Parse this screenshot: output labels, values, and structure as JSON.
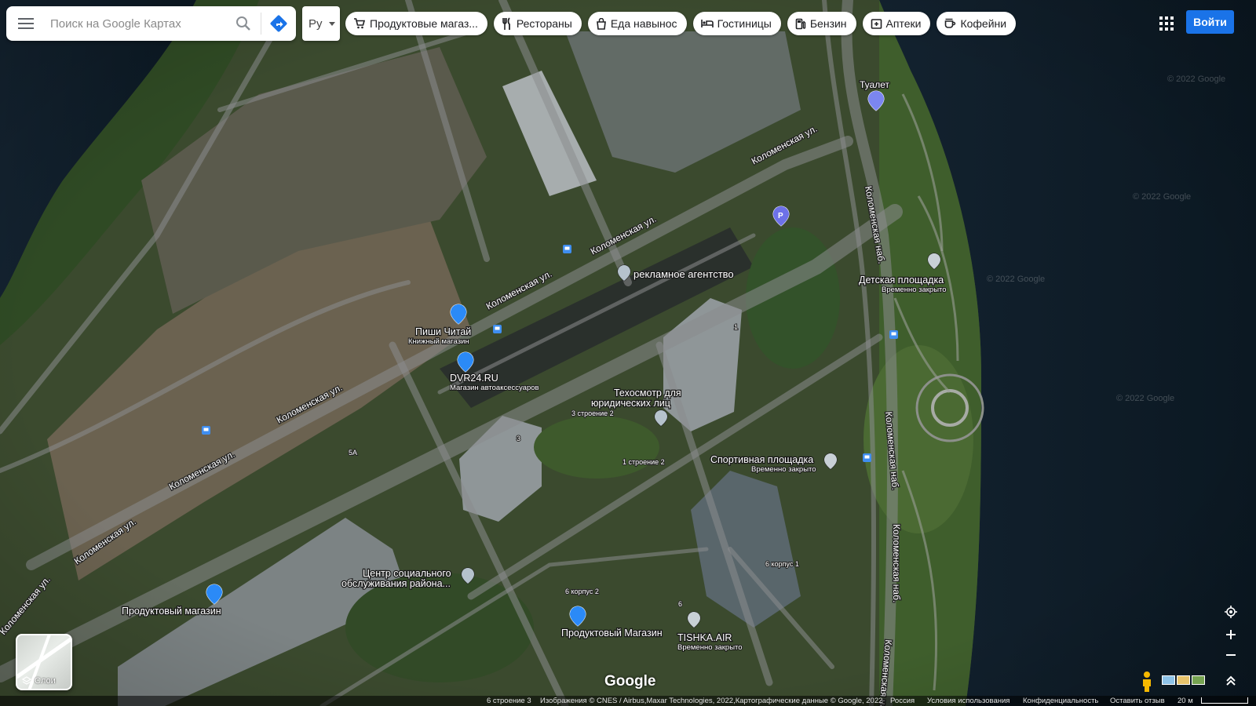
{
  "search": {
    "placeholder": "Поиск на Google Картах"
  },
  "language": {
    "selected": "Ру"
  },
  "chips": [
    {
      "label": "Продуктовые магаз...",
      "icon": "cart-icon"
    },
    {
      "label": "Рестораны",
      "icon": "fork-knife-icon"
    },
    {
      "label": "Еда навынос",
      "icon": "takeout-bag-icon"
    },
    {
      "label": "Гостиницы",
      "icon": "bed-icon"
    },
    {
      "label": "Бензин",
      "icon": "fuel-pump-icon"
    },
    {
      "label": "Аптеки",
      "icon": "pharmacy-icon"
    },
    {
      "label": "Кофейни",
      "icon": "coffee-cup-icon"
    }
  ],
  "header": {
    "login_label": "Войти"
  },
  "layers": {
    "label": "Слои"
  },
  "streets": [
    {
      "name": "Коломенская ул."
    },
    {
      "name": "Коломенская ул."
    },
    {
      "name": "Коломенская ул."
    },
    {
      "name": "Коломенская ул."
    },
    {
      "name": "Коломенская ул."
    },
    {
      "name": "Коломенская ул."
    },
    {
      "name": "Коломенская ул."
    },
    {
      "name": "Коломенская наб."
    },
    {
      "name": "Коломенская наб."
    },
    {
      "name": "Коломенская наб."
    },
    {
      "name": "Коломенская наб."
    }
  ],
  "places": [
    {
      "name": "Туалет",
      "sub": "",
      "icon": "restroom-pin-icon",
      "color": "#7b86f0"
    },
    {
      "name": "",
      "sub": "",
      "icon": "parking-pin-icon",
      "color": "#6d71e8"
    },
    {
      "name": "рекламное агентство",
      "sub": "",
      "icon": "place-pin-icon",
      "color": "#b5c2cc"
    },
    {
      "name": "Детская площадка",
      "sub": "Временно закрыто",
      "icon": "playground-pin-icon",
      "color": "#c8d0d6"
    },
    {
      "name": "Пиши Читай",
      "sub": "Книжный магазин",
      "icon": "shop-pin-icon",
      "color": "#2b8af7"
    },
    {
      "name": "DVR24.RU",
      "sub": "Магазин автоаксессуаров",
      "icon": "shop-pin-icon",
      "color": "#2b8af7"
    },
    {
      "name": "Техосмотр для юридических лиц",
      "sub": "",
      "icon": "place-pin-icon",
      "color": "#b5c2cc"
    },
    {
      "name": "Спортивная площадка",
      "sub": "Временно закрыто",
      "icon": "place-pin-icon",
      "color": "#c8d0d6"
    },
    {
      "name": "Центр социального обслуживания района...",
      "sub": "",
      "icon": "place-pin-icon",
      "color": "#b5c2cc"
    },
    {
      "name": "Продуктовый магазин",
      "sub": "",
      "icon": "grocery-pin-icon",
      "color": "#2b8af7"
    },
    {
      "name": "Продуктовый Магазин",
      "sub": "",
      "icon": "shop-pin-icon",
      "color": "#2b8af7"
    },
    {
      "name": "TISHKA.AIR",
      "sub": "Временно закрыто",
      "icon": "place-pin-icon",
      "color": "#c8d0d6"
    }
  ],
  "building_labels": [
    "3 строение 2",
    "1 строение 2",
    "3",
    "5А",
    "1",
    "6 корпус 1",
    "6 корпус 2",
    "6"
  ],
  "transit_stops": 6,
  "watermark": "© 2022 Google",
  "footer": {
    "building": "6 строение 3",
    "imagery": "Изображения © CNES / Airbus,Maxar Technologies, 2022,Картографические данные © Google, 2022",
    "country": "Россия",
    "terms": "Условия использования",
    "privacy": "Конфиденциальность",
    "feedback": "Оставить отзыв",
    "scale": "20 м"
  },
  "google_logo": "Google",
  "colors": {
    "accent": "#1a73e8",
    "river": "#0e1e2b",
    "pin_blue": "#2b8af7",
    "pin_purple": "#7b86f0"
  }
}
